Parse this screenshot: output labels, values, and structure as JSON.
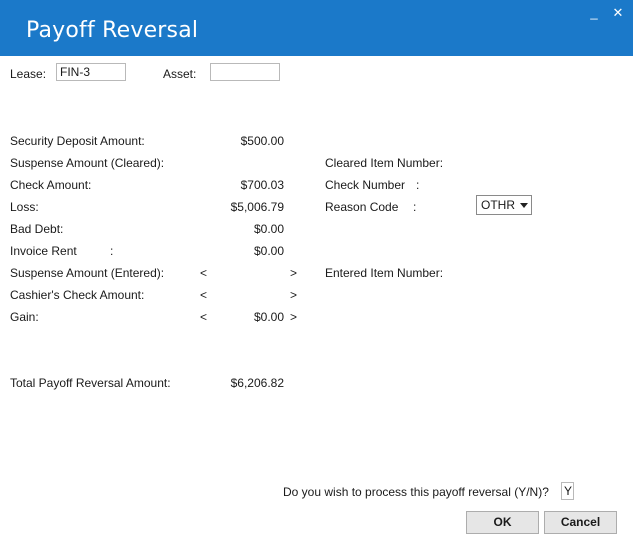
{
  "window": {
    "title": "Payoff Reversal",
    "minimize_glyph": "_",
    "close_glyph": "✕"
  },
  "header": {
    "lease_label": "Lease:",
    "lease_value": "FIN-3",
    "asset_label": "Asset:",
    "asset_value": ""
  },
  "left_rows": [
    {
      "label": "Security Deposit Amount:",
      "value": "$500.00"
    },
    {
      "label": "Suspense Amount (Cleared):",
      "value": ""
    },
    {
      "label": "Check Amount:",
      "value": "$700.03"
    },
    {
      "label": "Loss:",
      "value": "$5,006.79"
    },
    {
      "label": "Bad Debt:",
      "value": "$0.00"
    },
    {
      "label": "Invoice Rent",
      "colon": ":",
      "value": "$0.00"
    },
    {
      "label": "Suspense Amount (Entered):",
      "value": ""
    },
    {
      "label": "Cashier's Check Amount:",
      "value": ""
    },
    {
      "label": "Gain:",
      "value": "$0.00"
    }
  ],
  "arrows": {
    "left": "<",
    "right": ">"
  },
  "right_rows": {
    "cleared_item_number": "Cleared Item Number:",
    "check_number": "Check Number",
    "check_number_colon": ":",
    "reason_code": "Reason Code",
    "reason_code_colon": ":",
    "reason_code_value": "OTHR",
    "entered_item_number": "Entered Item Number:"
  },
  "total": {
    "label": "Total Payoff Reversal Amount:",
    "value": "$6,206.82"
  },
  "prompt": {
    "question": "Do you wish to process this payoff reversal (Y/N)?",
    "answer": "Y"
  },
  "buttons": {
    "ok": "OK",
    "cancel": "Cancel"
  }
}
